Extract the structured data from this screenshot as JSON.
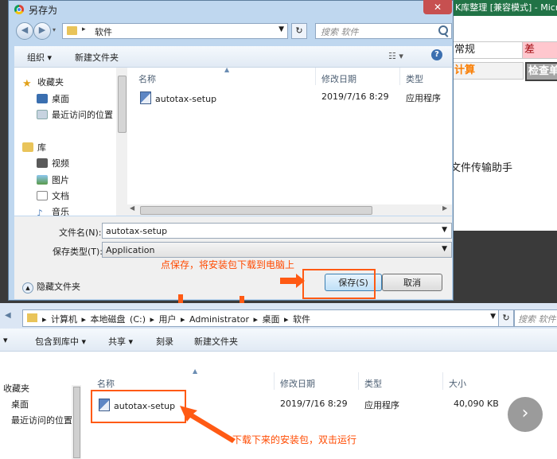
{
  "excel_bg": {
    "title": "K库整理 [兼容模式] - Micr",
    "cell_normal": "常规",
    "cell_bad": "差",
    "cell_calc": "计算",
    "cell_check": "检查单",
    "helper_text": "文件传输助手"
  },
  "dialog": {
    "title": "另存为",
    "address": "软件",
    "search_placeholder": "搜索 软件",
    "toolbar": {
      "organize": "组织",
      "new_folder": "新建文件夹"
    },
    "nav": {
      "favorites": "收藏夹",
      "desktop": "桌面",
      "recent": "最近访问的位置",
      "libraries": "库",
      "videos": "视频",
      "pictures": "图片",
      "documents": "文档",
      "music": "音乐"
    },
    "columns": {
      "name": "名称",
      "date": "修改日期",
      "type": "类型"
    },
    "file": {
      "name": "autotax-setup",
      "date": "2019/7/16 8:29",
      "type": "应用程序"
    },
    "filename_label": "文件名(N):",
    "filename_value": "autotax-setup",
    "filetype_label": "保存类型(T):",
    "filetype_value": "Application",
    "hide_folders": "隐藏文件夹",
    "save_button": "保存(S)",
    "cancel_button": "取消"
  },
  "annotations": {
    "save_hint": "点保存，将安装包下载到电脑上",
    "run_hint": "下载下来的安装包，双击运行"
  },
  "explorer": {
    "breadcrumb": "▸ 计算机 ▸ 本地磁盘 (C:) ▸ 用户 ▸ Administrator ▸ 桌面 ▸ 软件",
    "search_placeholder": "搜索 软件",
    "toolbar": {
      "include": "包含到库中",
      "share": "共享",
      "burn": "刻录",
      "new_folder": "新建文件夹"
    },
    "nav": {
      "favorites": "收藏夹",
      "desktop": "桌面",
      "recent": "最近访问的位置"
    },
    "columns": {
      "name": "名称",
      "date": "修改日期",
      "type": "类型",
      "size": "大小"
    },
    "file": {
      "name": "autotax-setup",
      "date": "2019/7/16 8:29",
      "type": "应用程序",
      "size": "40,090 KB"
    }
  },
  "colors": {
    "annotation": "#ff4a00",
    "highlight": "#ff5a14"
  }
}
